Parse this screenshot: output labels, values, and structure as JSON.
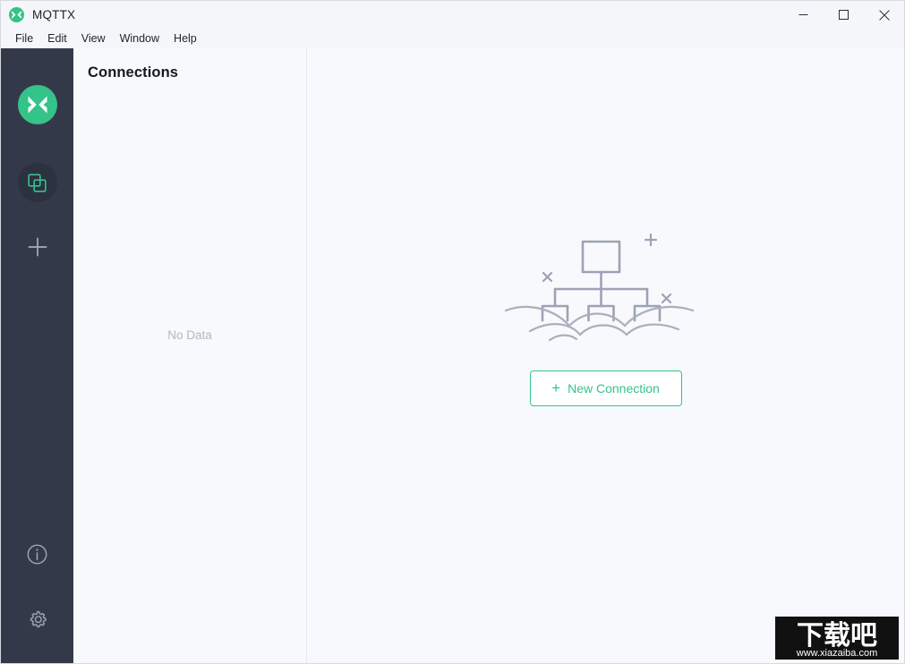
{
  "window": {
    "title": "MQTTX",
    "app_icon": "mqttx-logo-icon",
    "controls": {
      "minimize": "minimize-icon",
      "maximize": "maximize-icon",
      "close": "close-icon"
    }
  },
  "menubar": {
    "items": [
      {
        "label": "File"
      },
      {
        "label": "Edit"
      },
      {
        "label": "View"
      },
      {
        "label": "Window"
      },
      {
        "label": "Help"
      }
    ]
  },
  "rail": {
    "logo": "mqttx-logo-icon",
    "items": [
      {
        "name": "connections",
        "icon": "overlapping-squares-icon",
        "active": true
      },
      {
        "name": "new",
        "icon": "plus-icon",
        "active": false
      }
    ],
    "bottom_items": [
      {
        "name": "about",
        "icon": "info-circle-icon"
      },
      {
        "name": "settings",
        "icon": "gear-icon"
      }
    ]
  },
  "list_pane": {
    "title": "Connections",
    "empty_text": "No Data"
  },
  "content": {
    "illustration": "empty-connections-illustration",
    "new_connection_button": {
      "icon": "plus-icon",
      "label": "New Connection"
    }
  },
  "watermark": {
    "text": "下载吧",
    "url": "www.xiazaiba.com"
  },
  "colors": {
    "accent": "#34c388",
    "rail_bg": "#34394a",
    "rail_active": "#2c3140",
    "pane_bg": "#f8f9fc",
    "titlebar_bg": "#f4f6f9",
    "illustration_stroke": "#9ba3b4",
    "muted_text": "#b3b7bf"
  }
}
